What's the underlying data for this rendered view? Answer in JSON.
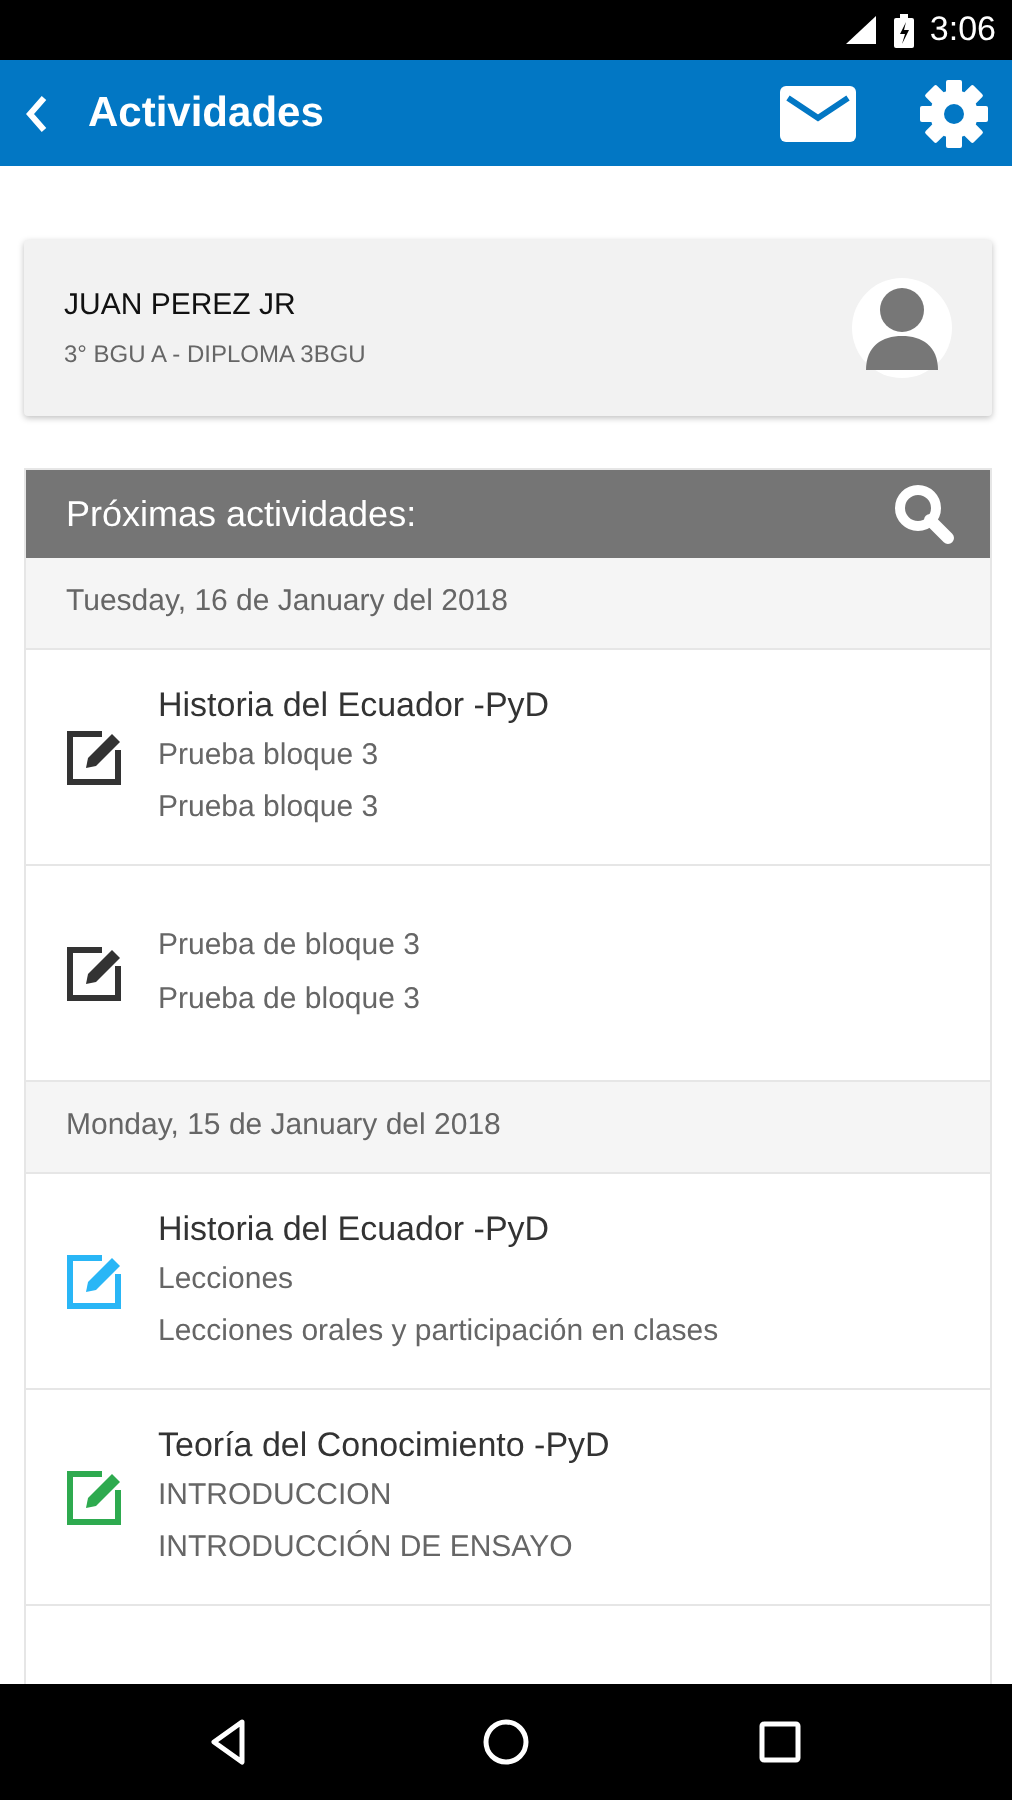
{
  "status_bar": {
    "time": "3:06"
  },
  "app_bar": {
    "title": "Actividades"
  },
  "profile": {
    "name": "JUAN PEREZ JR",
    "course": "3° BGU A - DIPLOMA 3BGU"
  },
  "activities": {
    "title": "Próximas actividades:",
    "days": [
      {
        "date": "Tuesday, 16 de January del 2018",
        "items": [
          {
            "color": "#333333",
            "subject": "Historia del Ecuador -PyD",
            "lines": [
              "Prueba bloque 3",
              "Prueba bloque 3"
            ]
          },
          {
            "color": "#333333",
            "lines": [
              "Prueba de bloque 3",
              "Prueba de bloque 3"
            ]
          }
        ]
      },
      {
        "date": "Monday, 15 de January del 2018",
        "items": [
          {
            "color": "#29b6f6",
            "subject": "Historia del Ecuador -PyD",
            "lines": [
              "Lecciones",
              "Lecciones orales y participación en clases"
            ]
          },
          {
            "color": "#2eaa4f",
            "subject": "Teoría del Conocimiento -PyD",
            "lines": [
              "INTRODUCCION",
              "INTRODUCCIÓN DE ENSAYO"
            ]
          }
        ]
      }
    ]
  }
}
